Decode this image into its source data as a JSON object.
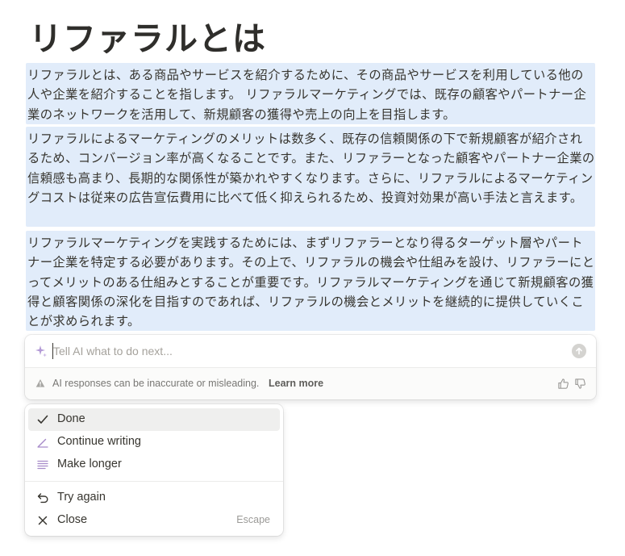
{
  "page": {
    "title": "リファラルとは",
    "paragraphs": [
      "リファラルとは、ある商品やサービスを紹介するために、その商品やサービスを利用している他の人や企業を紹介することを指します。 リファラルマーケティングでは、既存の顧客やパートナー企業のネットワークを活用して、新規顧客の獲得や売上の向上を目指します。",
      "リファラルによるマーケティングのメリットは数多く、既存の信頼関係の下で新規顧客が紹介されるため、コンバージョン率が高くなることです。また、リファラーとなった顧客やパートナー企業の信頼感も高まり、長期的な関係性が築かれやすくなります。さらに、リファラルによるマーケティングコストは従来の広告宣伝費用に比べて低く抑えられるため、投資対効果が高い手法と言えます。",
      "リファラルマーケティングを実践するためには、まずリファラーとなり得るターゲット層やパートナー企業を特定する必要があります。その上で、リファラルの機会や仕組みを設け、リファラーにとってメリットのある仕組みとすることが重要です。リファラルマーケティングを通じて新規顧客の獲得と顧客関係の深化を目指すのであれば、リファラルの機会とメリットを継続的に提供していくことが求められます。"
    ]
  },
  "ai_prompt": {
    "placeholder": "Tell AI what to do next...",
    "value": "",
    "disclaimer": "AI responses can be inaccurate or misleading.",
    "learn_more": "Learn more",
    "icons": [
      "sparkle-icon",
      "send-arrow-icon",
      "warning-icon",
      "thumbs-up-icon",
      "thumbs-down-icon"
    ],
    "colors": {
      "sparkle": "#a78bc9",
      "selection": "#e1ecfa"
    }
  },
  "menu": {
    "items": [
      {
        "label": "Done",
        "icon": "checkmark-icon",
        "shortcut": ""
      },
      {
        "label": "Continue writing",
        "icon": "pen-icon",
        "shortcut": ""
      },
      {
        "label": "Make longer",
        "icon": "lines-icon",
        "shortcut": ""
      },
      {
        "label": "Try again",
        "icon": "undo-arrow-icon",
        "shortcut": ""
      },
      {
        "label": "Close",
        "icon": "close-icon",
        "shortcut": "Escape"
      }
    ],
    "active_item": "Done"
  }
}
